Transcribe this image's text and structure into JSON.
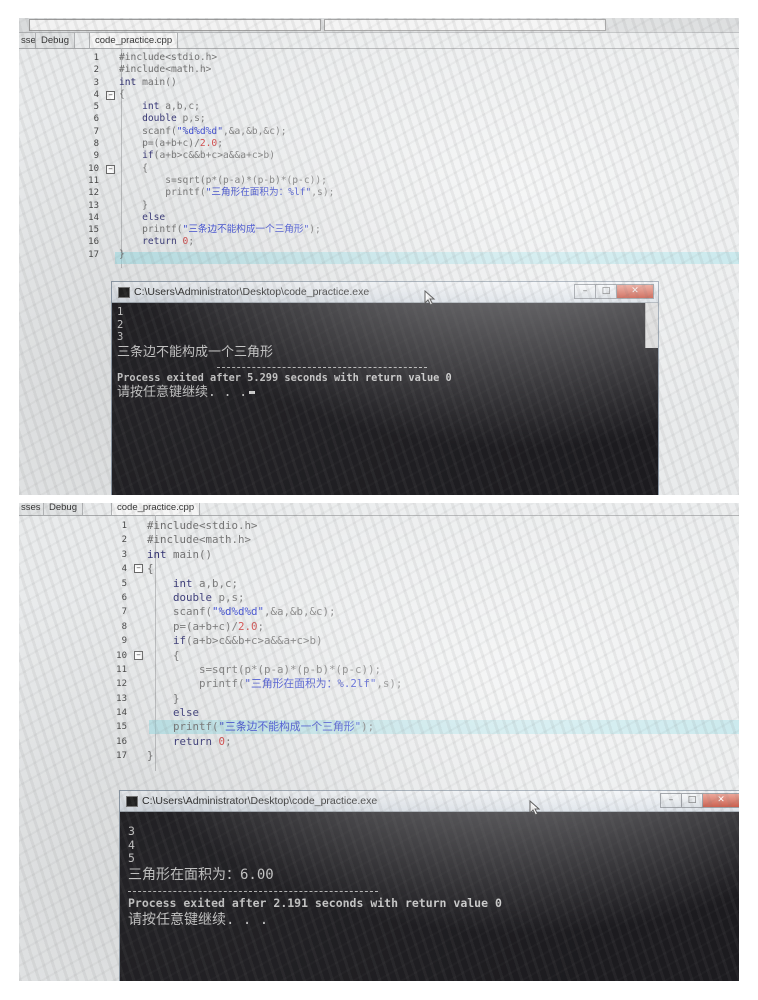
{
  "shot1": {
    "tabs": [
      {
        "label": "sses"
      },
      {
        "label": "Debug"
      },
      {
        "label": "code_practice.cpp"
      }
    ],
    "editor": {
      "lines": [
        {
          "n": "1",
          "code": "#include<stdio.h>"
        },
        {
          "n": "2",
          "code": "#include<math.h>"
        },
        {
          "n": "3",
          "code": "int main()"
        },
        {
          "n": "4",
          "code": "{"
        },
        {
          "n": "5",
          "code": "    int a,b,c;"
        },
        {
          "n": "6",
          "code": "    double p,s;"
        },
        {
          "n": "7",
          "code": "    scanf(\"%d%d%d\",&a,&b,&c);"
        },
        {
          "n": "8",
          "code": "    p=(a+b+c)/2.0;"
        },
        {
          "n": "9",
          "code": "    if(a+b>c&&b+c>a&&a+c>b)"
        },
        {
          "n": "10",
          "code": "    {"
        },
        {
          "n": "11",
          "code": "        s=sqrt(p*(p-a)*(p-b)*(p-c));"
        },
        {
          "n": "12",
          "code": "        printf(\"三角形在面积为：%lf\",s);"
        },
        {
          "n": "13",
          "code": "    }"
        },
        {
          "n": "14",
          "code": "    else"
        },
        {
          "n": "15",
          "code": "    printf(\"三条边不能构成一个三角形\");"
        },
        {
          "n": "16",
          "code": "    return 0;"
        },
        {
          "n": "17",
          "code": "}"
        }
      ]
    },
    "console": {
      "title": "C:\\Users\\Administrator\\Desktop\\code_practice.exe",
      "buttons": {
        "minimize": "–",
        "maximize": "□",
        "close": "✕"
      },
      "inputs": [
        "1",
        "2",
        "3"
      ],
      "result": "三条边不能构成一个三角形",
      "process": "Process exited after 5.299 seconds with return value 0",
      "prompt": "请按任意键继续. . ."
    }
  },
  "shot2": {
    "tabs": [
      {
        "label": "sses"
      },
      {
        "label": "Debug"
      },
      {
        "label": "code_practice.cpp"
      }
    ],
    "editor": {
      "lines": [
        {
          "n": "1",
          "code": "#include<stdio.h>"
        },
        {
          "n": "2",
          "code": "#include<math.h>"
        },
        {
          "n": "3",
          "code": "int main()"
        },
        {
          "n": "4",
          "code": "{"
        },
        {
          "n": "5",
          "code": "    int a,b,c;"
        },
        {
          "n": "6",
          "code": "    double p,s;"
        },
        {
          "n": "7",
          "code": "    scanf(\"%d%d%d\",&a,&b,&c);"
        },
        {
          "n": "8",
          "code": "    p=(a+b+c)/2.0;"
        },
        {
          "n": "9",
          "code": "    if(a+b>c&&b+c>a&&a+c>b)"
        },
        {
          "n": "10",
          "code": "    {"
        },
        {
          "n": "11",
          "code": "        s=sqrt(p*(p-a)*(p-b)*(p-c));"
        },
        {
          "n": "12",
          "code": "        printf(\"三角形在面积为：%.2lf\",s);"
        },
        {
          "n": "13",
          "code": "    }"
        },
        {
          "n": "14",
          "code": "    else"
        },
        {
          "n": "15",
          "code": "    printf(\"三条边不能构成一个三角形\");"
        },
        {
          "n": "16",
          "code": "    return 0;"
        },
        {
          "n": "17",
          "code": "}"
        }
      ]
    },
    "console": {
      "title": "C:\\Users\\Administrator\\Desktop\\code_practice.exe",
      "buttons": {
        "minimize": "–",
        "maximize": "□",
        "close": "✕"
      },
      "inputs": [
        "3",
        "4",
        "5"
      ],
      "result": "三角形在面积为：6.00",
      "process": "Process exited after 2.191 seconds with return value 0",
      "prompt": "请按任意键继续. . ."
    }
  },
  "colors": {
    "console_bg": "#1c1b1f",
    "line_highlight": "#96dce6",
    "string": "#2233cc",
    "number": "#cc3333"
  }
}
